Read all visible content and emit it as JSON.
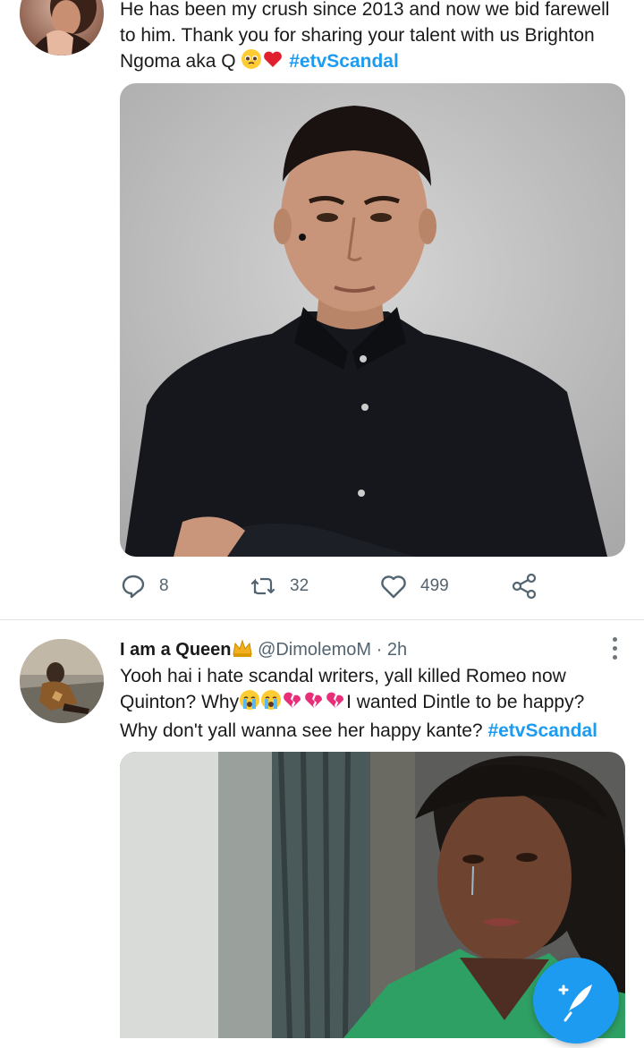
{
  "tweet1": {
    "text_line1": "He has been my crush since 2013 and now we bid farewell",
    "text_line2": "to him. Thank you for sharing your talent with us Brighton",
    "text_line3_prefix": "Ngoma aka Q",
    "hashtag": "#etvScandal",
    "media_description": "Photo of man in dark shirt",
    "actions": {
      "replies": "8",
      "retweets": "32",
      "likes": "499"
    }
  },
  "tweet2": {
    "display_name": "I am a Queen",
    "handle": "@DimolemoM",
    "separator": "·",
    "time": "2h",
    "text_line1": "Yooh hai i hate scandal writers, yall killed Romeo now",
    "text_line2_prefix": "Quinton? Why",
    "text_line2_suffix": "I wanted Dintle to be happy?",
    "text_line3_prefix": "Why don't yall wanna see her happy kante?",
    "hashtag": "#etvScandal"
  },
  "colors": {
    "accent": "#1d9bf0",
    "muted": "#536471",
    "divider": "#dfe3e6"
  },
  "icons": {
    "reply": "reply-icon",
    "retweet": "retweet-icon",
    "like": "heart-icon",
    "share": "share-icon",
    "more": "more-vertical-icon",
    "compose": "compose-feather-icon"
  }
}
